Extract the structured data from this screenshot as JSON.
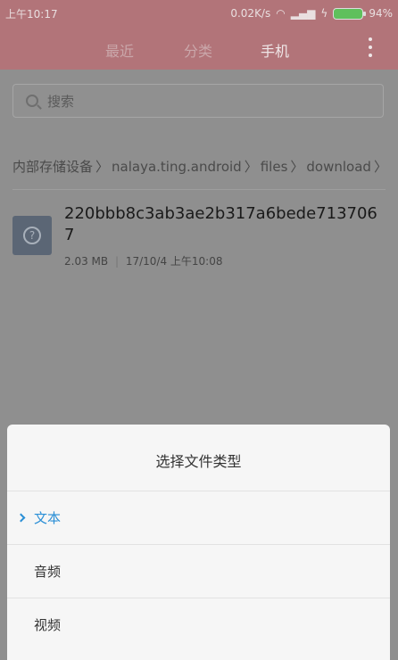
{
  "status": {
    "time": "上午10:17",
    "speed": "0.02K/s",
    "battery": "94%"
  },
  "tabs": [
    {
      "label": "最近"
    },
    {
      "label": "分类"
    },
    {
      "label": "手机"
    }
  ],
  "search": {
    "placeholder": "搜索"
  },
  "breadcrumb": [
    "内部存储设备",
    "nalaya.ting.android",
    "files",
    "download"
  ],
  "file": {
    "name": "220bbb8c3ab3ae2b317a6bede7137067",
    "size": "2.03 MB",
    "date": "17/10/4 上午10:08"
  },
  "dialog": {
    "title": "选择文件类型",
    "options": [
      {
        "label": "文本",
        "selected": true
      },
      {
        "label": "音频"
      },
      {
        "label": "视频"
      }
    ]
  }
}
